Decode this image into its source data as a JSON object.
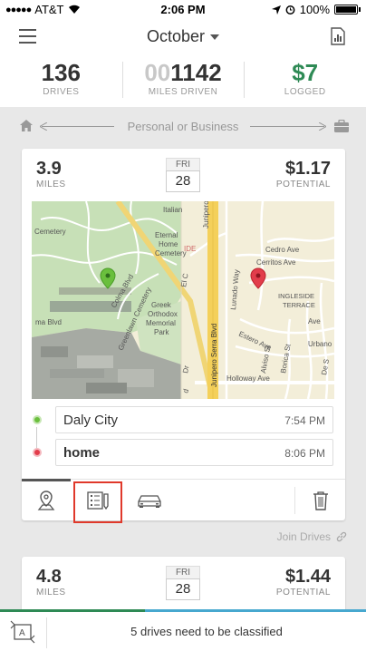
{
  "status_bar": {
    "carrier": "AT&T",
    "time": "2:06 PM",
    "battery": "100%"
  },
  "nav": {
    "month": "October",
    "menu_icon": "hamburger-icon",
    "report_icon": "report-icon"
  },
  "stats": {
    "drives": {
      "value": "136",
      "label": "DRIVES"
    },
    "miles": {
      "value_dim": "00",
      "value": "1142",
      "label": "MILES DRIVEN"
    },
    "logged": {
      "value": "$7",
      "label": "LOGGED"
    }
  },
  "classify_bar": {
    "label": "Personal or Business",
    "left_icon": "home-icon",
    "right_icon": "briefcase-icon"
  },
  "drives": [
    {
      "miles": "3.9",
      "miles_label": "MILES",
      "day_of_week": "FRI",
      "day": "28",
      "potential": "$1.17",
      "potential_label": "POTENTIAL",
      "start": {
        "name": "Daly City",
        "time": "7:54 PM",
        "color": "#6abf3d"
      },
      "end": {
        "name": "home",
        "time": "8:06 PM",
        "color": "#e23d4b"
      },
      "map_labels": {
        "cemetery": "Cemetery",
        "italian": "Italian",
        "eternal": "Eternal",
        "home_label": "Home",
        "cemetery2": "Cemetery",
        "ide": "IDE",
        "junipero": "Junipero",
        "cedro": "Cedro Ave",
        "cerritos": "Cerritos Ave",
        "ingleside": "INGLESIDE",
        "terrace": "TERRACE",
        "greek": "Greek",
        "orthodox": "Orthodox",
        "memorial": "Memorial",
        "park": "Park",
        "coma_blvd": "Colma Blvd",
        "greenlawn": "Greenlawn Cemetery",
        "ma_blvd": "ma Blvd",
        "el_c": "El C",
        "junipero_serra": "Junipero Serra Blvd",
        "d": "d",
        "lunado": "Lunado Way",
        "estero": "Estero Ave",
        "urbano": "Urbano Dr",
        "alviso": "Alviso St",
        "borica": "Borica St",
        "holloway": "Holloway Ave",
        "dr": "Dr",
        "ave": "Ave",
        "de": "De S"
      }
    },
    {
      "miles": "4.8",
      "miles_label": "MILES",
      "day_of_week": "FRI",
      "day": "28",
      "potential": "$1.44",
      "potential_label": "POTENTIAL"
    }
  ],
  "card_tabs": [
    {
      "name": "map-pin-icon"
    },
    {
      "name": "notes-icon"
    },
    {
      "name": "car-icon"
    },
    {
      "name": "trash-icon"
    }
  ],
  "join_drives": "Join Drives",
  "bottom_bar": {
    "message": "5 drives need to be classified",
    "icon": "auto-classify-icon"
  },
  "colors": {
    "green": "#2e8a55",
    "start_pin": "#6abf3d",
    "end_pin": "#e23d4b",
    "highlight": "#e0392b",
    "accent_blue": "#47a8cf"
  }
}
